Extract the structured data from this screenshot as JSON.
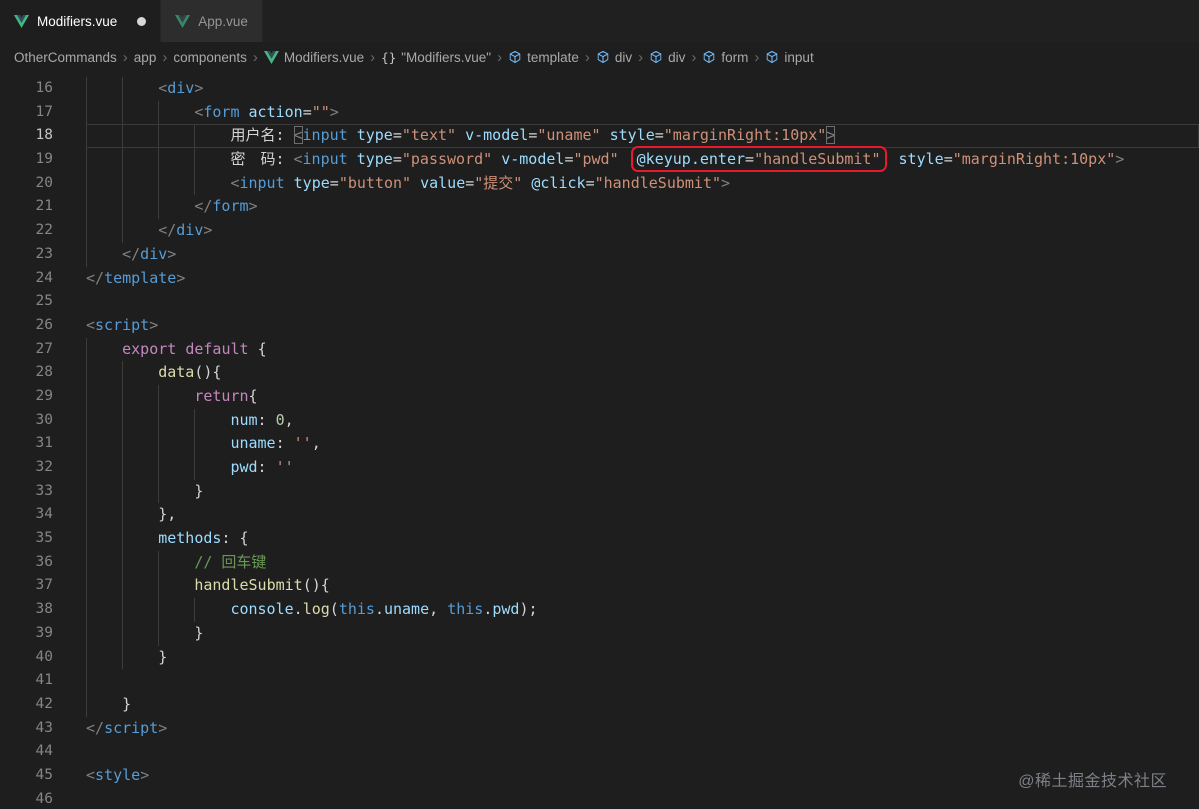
{
  "colors": {
    "annotation_box": "#e8192c",
    "tag": "#569cd6",
    "attribute": "#9cdcfe",
    "string": "#ce9178",
    "keyword": "#c586c0",
    "function": "#dcdcaa",
    "number": "#b5cea8",
    "comment": "#6a9955"
  },
  "tabs": [
    {
      "label": "Modifiers.vue",
      "icon": "vue",
      "active": true,
      "modified": true
    },
    {
      "label": "App.vue",
      "icon": "vue",
      "active": false,
      "modified": false
    }
  ],
  "breadcrumb": [
    {
      "label": "OtherCommands",
      "icon": null
    },
    {
      "label": "app",
      "icon": null
    },
    {
      "label": "components",
      "icon": null
    },
    {
      "label": "Modifiers.vue",
      "icon": "vue"
    },
    {
      "label": "\"Modifiers.vue\"",
      "icon": "braces"
    },
    {
      "label": "template",
      "icon": "symbol"
    },
    {
      "label": "div",
      "icon": "symbol"
    },
    {
      "label": "div",
      "icon": "symbol"
    },
    {
      "label": "form",
      "icon": "symbol"
    },
    {
      "label": "input",
      "icon": "symbol"
    }
  ],
  "watermark": "@稀土掘金技术社区",
  "editor": {
    "language": "vue",
    "current_line": 18,
    "lines": [
      {
        "no": 16,
        "ind": 2,
        "tok": [
          [
            "<",
            "p"
          ],
          [
            "div",
            "t"
          ],
          [
            ">",
            "p"
          ]
        ]
      },
      {
        "no": 17,
        "ind": 3,
        "tok": [
          [
            "<",
            "p"
          ],
          [
            "form",
            "t"
          ],
          [
            " ",
            "d"
          ],
          [
            "action",
            "a"
          ],
          [
            "=",
            "d"
          ],
          [
            "\"\"",
            "s"
          ],
          [
            ">",
            "p"
          ]
        ]
      },
      {
        "no": 18,
        "ind": 4,
        "cur": true,
        "tok": [
          [
            "用户名: ",
            "d"
          ],
          [
            "<",
            "p",
            "m"
          ],
          [
            "input",
            "t"
          ],
          [
            " ",
            "d"
          ],
          [
            "type",
            "a"
          ],
          [
            "=",
            "d"
          ],
          [
            "\"text\"",
            "s"
          ],
          [
            " ",
            "d"
          ],
          [
            "v-model",
            "a"
          ],
          [
            "=",
            "d"
          ],
          [
            "\"uname\"",
            "s"
          ],
          [
            " ",
            "d"
          ],
          [
            "style",
            "a"
          ],
          [
            "=",
            "d"
          ],
          [
            "\"marginRight:10px\"",
            "s"
          ],
          [
            ">",
            "p",
            "m"
          ]
        ]
      },
      {
        "no": 19,
        "ind": 4,
        "tok": [
          [
            "密　码: ",
            "d"
          ],
          [
            "<",
            "p"
          ],
          [
            "input",
            "t"
          ],
          [
            " ",
            "d"
          ],
          [
            "type",
            "a"
          ],
          [
            "=",
            "d"
          ],
          [
            "\"password\"",
            "s"
          ],
          [
            " ",
            "d"
          ],
          [
            "v-model",
            "a"
          ],
          [
            "=",
            "d"
          ],
          [
            "\"pwd\"",
            "s"
          ],
          [
            " ",
            "d"
          ],
          [
            "@keyup.enter",
            "a",
            "b"
          ],
          [
            "=",
            "d",
            "b"
          ],
          [
            "\"handleSubmit\"",
            "s",
            "b"
          ],
          [
            " ",
            "d"
          ],
          [
            "style",
            "a"
          ],
          [
            "=",
            "d"
          ],
          [
            "\"marginRight:10px\"",
            "s"
          ],
          [
            ">",
            "p"
          ]
        ]
      },
      {
        "no": 20,
        "ind": 4,
        "tok": [
          [
            "<",
            "p"
          ],
          [
            "input",
            "t"
          ],
          [
            " ",
            "d"
          ],
          [
            "type",
            "a"
          ],
          [
            "=",
            "d"
          ],
          [
            "\"button\"",
            "s"
          ],
          [
            " ",
            "d"
          ],
          [
            "value",
            "a"
          ],
          [
            "=",
            "d"
          ],
          [
            "\"提交\"",
            "s"
          ],
          [
            " ",
            "d"
          ],
          [
            "@click",
            "a"
          ],
          [
            "=",
            "d"
          ],
          [
            "\"handleSubmit\"",
            "s"
          ],
          [
            ">",
            "p"
          ]
        ]
      },
      {
        "no": 21,
        "ind": 3,
        "tok": [
          [
            "</",
            "p"
          ],
          [
            "form",
            "t"
          ],
          [
            ">",
            "p"
          ]
        ]
      },
      {
        "no": 22,
        "ind": 2,
        "tok": [
          [
            "</",
            "p"
          ],
          [
            "div",
            "t"
          ],
          [
            ">",
            "p"
          ]
        ]
      },
      {
        "no": 23,
        "ind": 1,
        "tok": [
          [
            "</",
            "p"
          ],
          [
            "div",
            "t"
          ],
          [
            ">",
            "p"
          ]
        ]
      },
      {
        "no": 24,
        "ind": 0,
        "tok": [
          [
            "</",
            "p"
          ],
          [
            "template",
            "t"
          ],
          [
            ">",
            "p"
          ]
        ]
      },
      {
        "no": 25,
        "ind": 0,
        "tok": []
      },
      {
        "no": 26,
        "ind": 0,
        "tok": [
          [
            "<",
            "p"
          ],
          [
            "script",
            "t"
          ],
          [
            ">",
            "p"
          ]
        ]
      },
      {
        "no": 27,
        "ind": 1,
        "tok": [
          [
            "export",
            "k"
          ],
          [
            " ",
            "d"
          ],
          [
            "default",
            "k"
          ],
          [
            " {",
            "d"
          ]
        ]
      },
      {
        "no": 28,
        "ind": 2,
        "tok": [
          [
            "data",
            "f"
          ],
          [
            "(){",
            "d"
          ]
        ]
      },
      {
        "no": 29,
        "ind": 3,
        "tok": [
          [
            "return",
            "k"
          ],
          [
            "{",
            "d"
          ]
        ]
      },
      {
        "no": 30,
        "ind": 4,
        "tok": [
          [
            "num",
            "v"
          ],
          [
            ": ",
            "d"
          ],
          [
            "0",
            "n"
          ],
          [
            ",",
            "d"
          ]
        ]
      },
      {
        "no": 31,
        "ind": 4,
        "tok": [
          [
            "uname",
            "v"
          ],
          [
            ": ",
            "d"
          ],
          [
            "''",
            "s"
          ],
          [
            ",",
            "d"
          ]
        ]
      },
      {
        "no": 32,
        "ind": 4,
        "tok": [
          [
            "pwd",
            "v"
          ],
          [
            ": ",
            "d"
          ],
          [
            "''",
            "s"
          ]
        ]
      },
      {
        "no": 33,
        "ind": 3,
        "tok": [
          [
            "}",
            "d"
          ]
        ]
      },
      {
        "no": 34,
        "ind": 2,
        "tok": [
          [
            "},",
            "d"
          ]
        ]
      },
      {
        "no": 35,
        "ind": 2,
        "tok": [
          [
            "methods",
            "v"
          ],
          [
            ": {",
            "d"
          ]
        ]
      },
      {
        "no": 36,
        "ind": 3,
        "tok": [
          [
            "// 回车键",
            "c"
          ]
        ]
      },
      {
        "no": 37,
        "ind": 3,
        "tok": [
          [
            "handleSubmit",
            "f"
          ],
          [
            "(){",
            "d"
          ]
        ]
      },
      {
        "no": 38,
        "ind": 4,
        "tok": [
          [
            "console",
            "v"
          ],
          [
            ".",
            "d"
          ],
          [
            "log",
            "f"
          ],
          [
            "(",
            "d"
          ],
          [
            "this",
            "h"
          ],
          [
            ".",
            "d"
          ],
          [
            "uname",
            "v"
          ],
          [
            ", ",
            "d"
          ],
          [
            "this",
            "h"
          ],
          [
            ".",
            "d"
          ],
          [
            "pwd",
            "v"
          ],
          [
            ");",
            "d"
          ]
        ]
      },
      {
        "no": 39,
        "ind": 3,
        "tok": [
          [
            "}",
            "d"
          ]
        ]
      },
      {
        "no": 40,
        "ind": 2,
        "tok": [
          [
            "}",
            "d"
          ]
        ]
      },
      {
        "no": 41,
        "ind": 1,
        "tok": []
      },
      {
        "no": 42,
        "ind": 1,
        "tok": [
          [
            "}",
            "d"
          ]
        ]
      },
      {
        "no": 43,
        "ind": 0,
        "tok": [
          [
            "</",
            "p"
          ],
          [
            "script",
            "t"
          ],
          [
            ">",
            "p"
          ]
        ]
      },
      {
        "no": 44,
        "ind": 0,
        "tok": []
      },
      {
        "no": 45,
        "ind": 0,
        "tok": [
          [
            "<",
            "p"
          ],
          [
            "style",
            "t"
          ],
          [
            ">",
            "p"
          ]
        ]
      },
      {
        "no": 46,
        "ind": 0,
        "tok": []
      }
    ]
  }
}
